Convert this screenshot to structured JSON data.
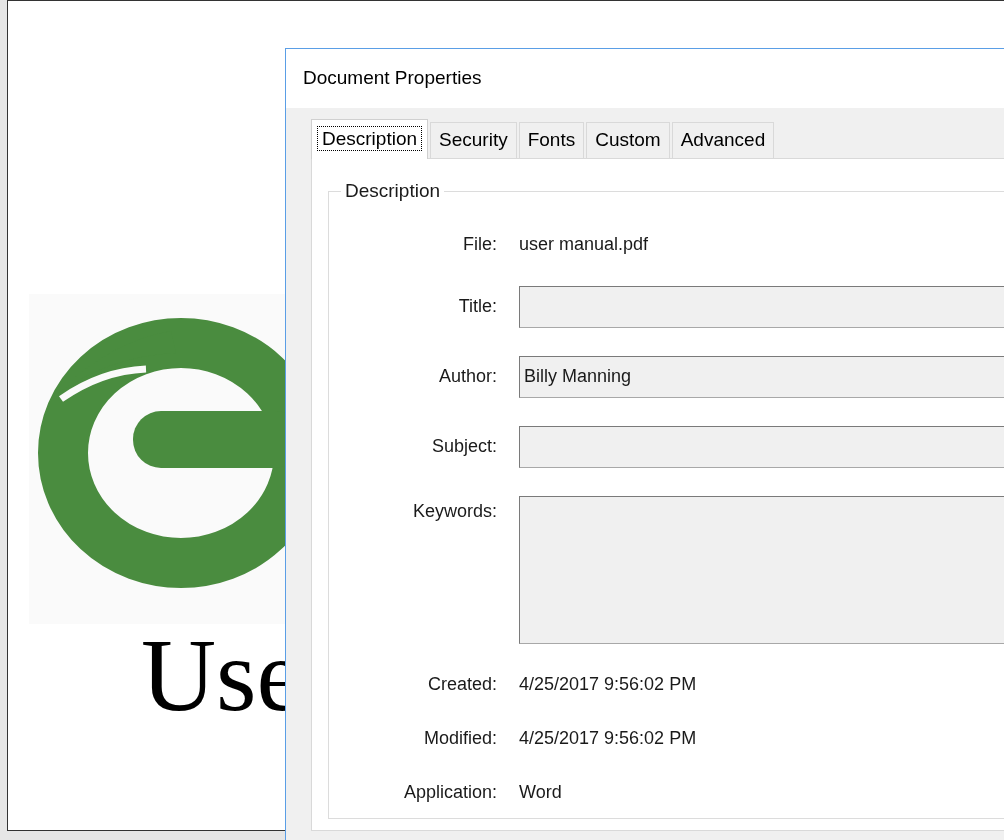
{
  "document": {
    "heading": "Use"
  },
  "dialog": {
    "title": "Document Properties",
    "tabs": [
      {
        "label": "Description",
        "selected": true
      },
      {
        "label": "Security",
        "selected": false
      },
      {
        "label": "Fonts",
        "selected": false
      },
      {
        "label": "Custom",
        "selected": false
      },
      {
        "label": "Advanced",
        "selected": false
      }
    ],
    "group": {
      "title": "Description",
      "fields": [
        {
          "label": "File:",
          "kind": "text",
          "value": "user manual.pdf"
        },
        {
          "label": "Title:",
          "kind": "input"
        },
        {
          "label": "Author:",
          "kind": "input",
          "value": "Billy Manning"
        },
        {
          "label": "Subject:",
          "kind": "input"
        },
        {
          "label": "Keywords:",
          "kind": "textarea"
        },
        {
          "label": "Created:",
          "kind": "text",
          "value": "4/25/2017 9:56:02 PM"
        },
        {
          "label": "Modified:",
          "kind": "text",
          "value": "4/25/2017 9:56:02 PM"
        },
        {
          "label": "Application:",
          "kind": "text",
          "value": "Word"
        }
      ]
    }
  }
}
